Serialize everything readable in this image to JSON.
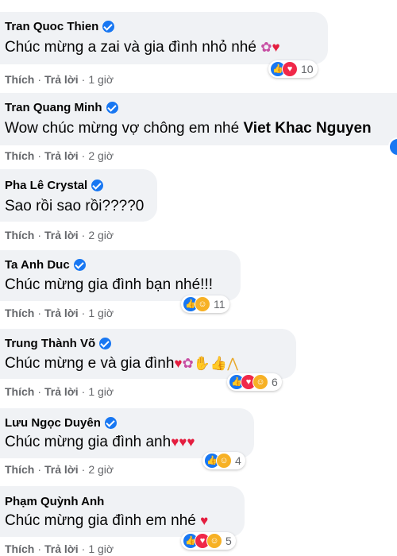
{
  "actions": {
    "like": "Thích",
    "reply": "Trả lời",
    "sep": "·"
  },
  "comments": [
    {
      "author": "Tran Quoc Thien",
      "text": "Chúc mừng a zai và gia đình nhỏ nhé",
      "time": "1 giờ",
      "reaction_count": "10",
      "emojis": [
        "flower",
        "heart"
      ],
      "reaction_icons": [
        "like-icon",
        "love-icon"
      ]
    },
    {
      "author": "Tran Quang Minh",
      "text": "Wow chúc mừng vợ chông em nhé",
      "mention": "Viet Khac Nguyen",
      "time": "2 giờ",
      "reaction_icons": [
        "like-icon"
      ]
    },
    {
      "author": "Pha Lê Crystal",
      "text": "Sao rồi sao rồi????0",
      "time": "2 giờ"
    },
    {
      "author": "Ta Anh Duc",
      "text": "Chúc mừng gia đình bạn nhé!!!",
      "time": "1 giờ",
      "reaction_count": "11",
      "reaction_icons": [
        "like-icon",
        "care-icon"
      ]
    },
    {
      "author": "Trung Thành Võ",
      "text": "Chúc mừng e và gia đình",
      "time": "1 giờ",
      "reaction_count": "6",
      "emojis": [
        "heart",
        "flower",
        "clap",
        "thumbs-up",
        "pray"
      ],
      "reaction_icons": [
        "like-icon",
        "love-icon",
        "care-icon"
      ]
    },
    {
      "author": "Lưu Ngọc Duyên",
      "text": "Chúc mừng gia đình anh",
      "time": "2 giờ",
      "reaction_count": "4",
      "emojis": [
        "heart",
        "heart",
        "heart"
      ],
      "reaction_icons": [
        "like-icon",
        "care-icon"
      ]
    },
    {
      "author": "Phạm Quỳnh Anh",
      "text": "Chúc mừng gia đình em nhé",
      "time": "1 giờ",
      "reaction_count": "5",
      "emojis": [
        "heart"
      ],
      "reaction_icons": [
        "like-icon",
        "love-icon",
        "care-icon"
      ]
    }
  ],
  "colors": {
    "bubble": "#f0f2f5",
    "verified": "#1877f2",
    "like": "#1877f2",
    "love": "#f02849",
    "care": "#f7b125",
    "meta": "#65676b"
  }
}
